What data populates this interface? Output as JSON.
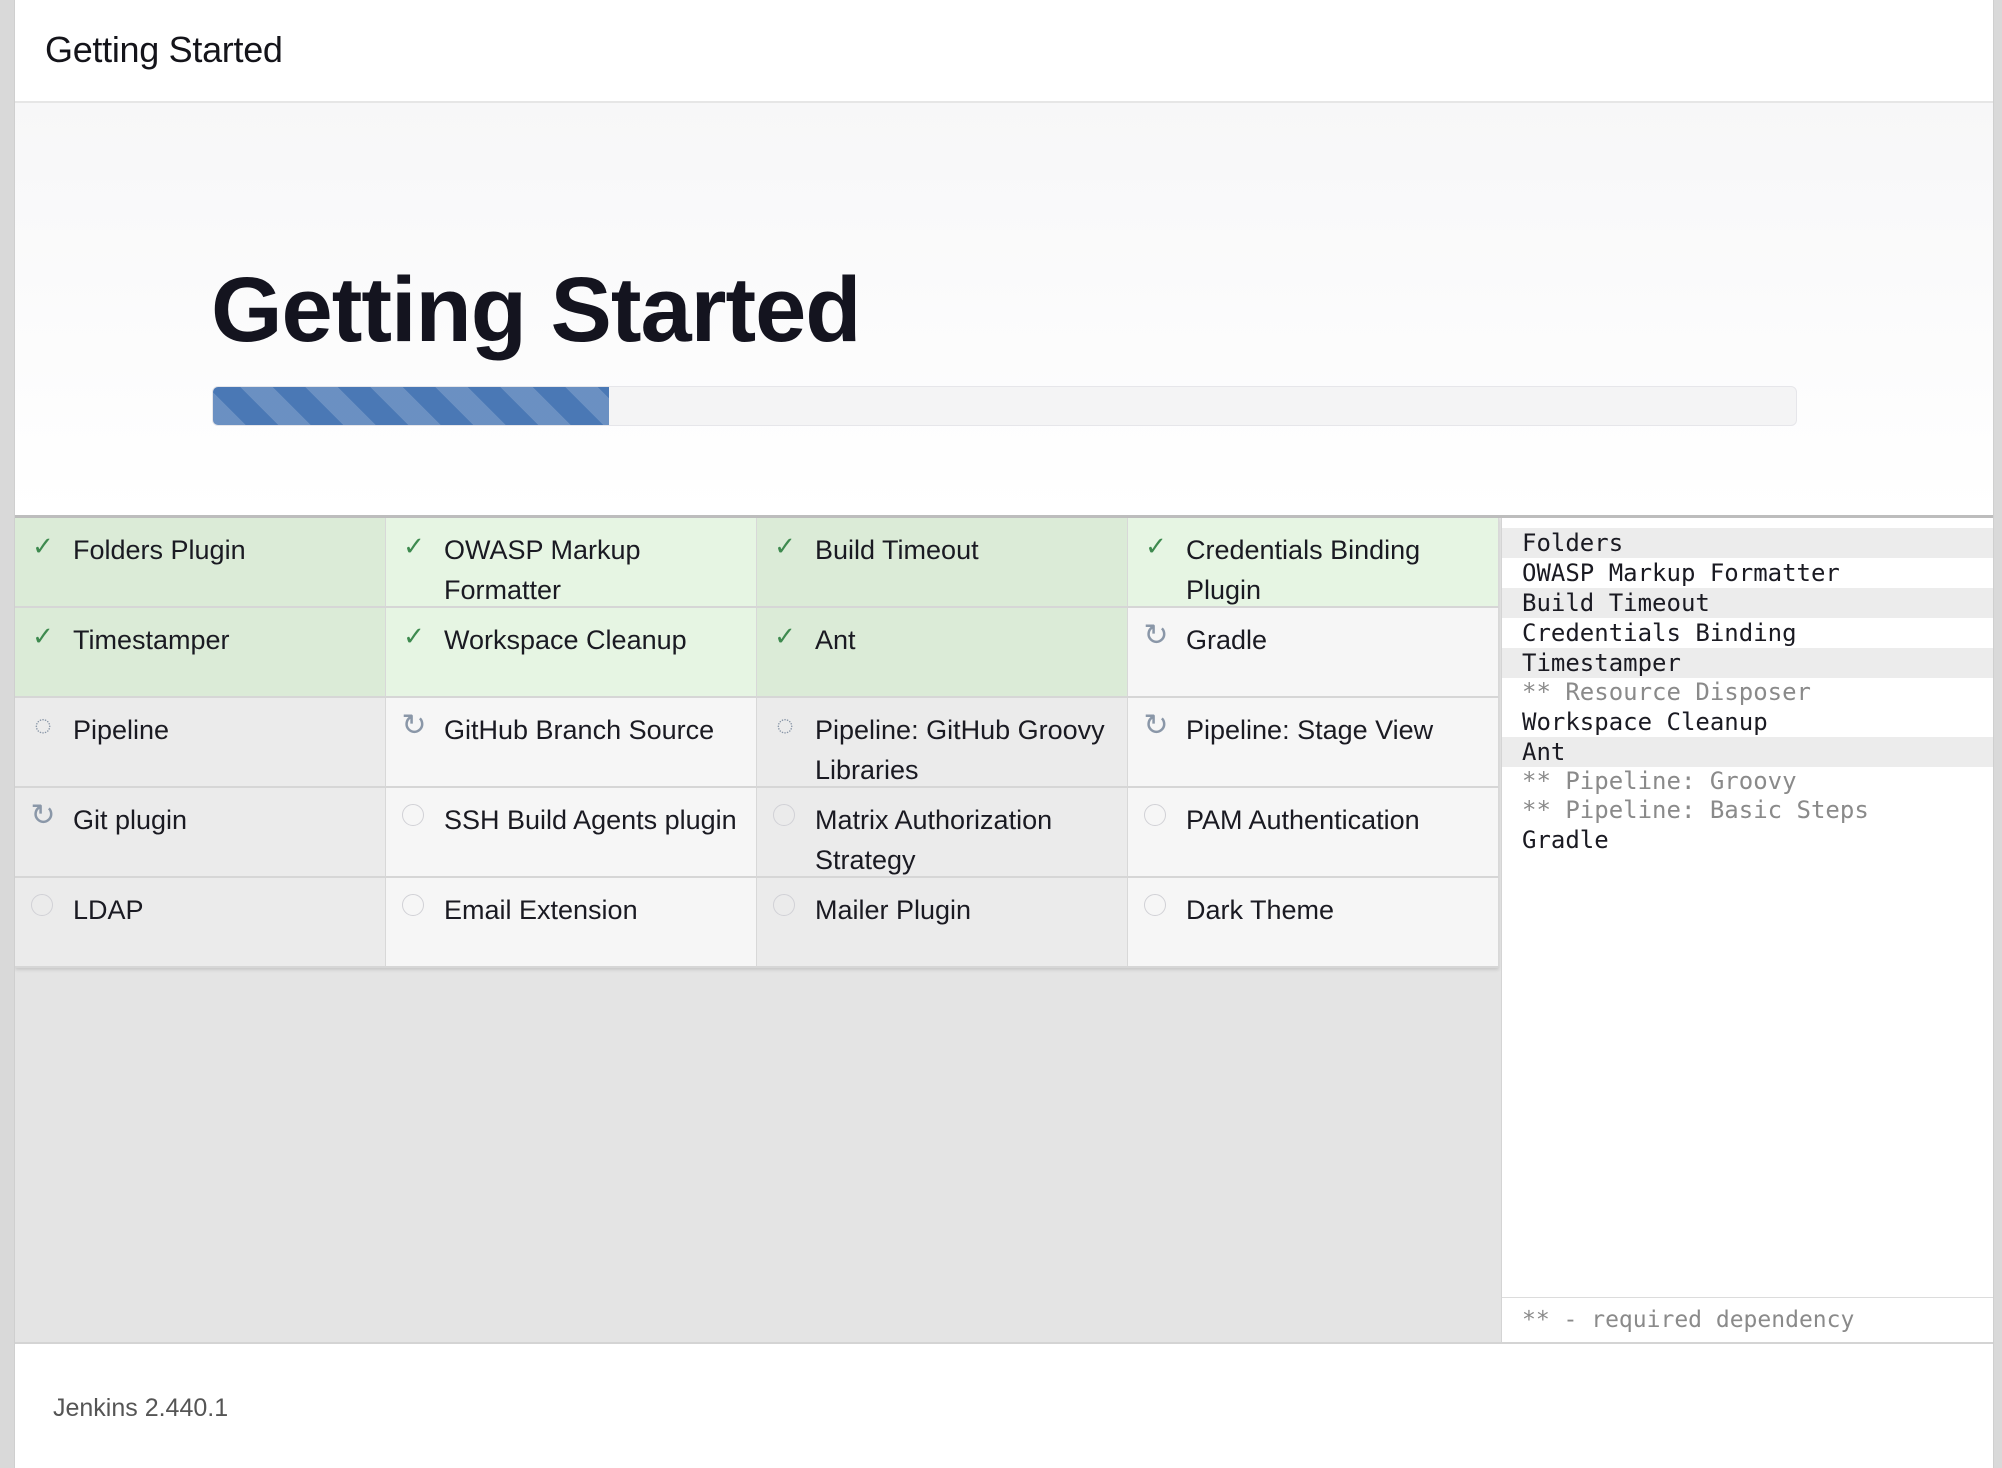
{
  "header": {
    "title": "Getting Started"
  },
  "hero": {
    "heading": "Getting Started",
    "progress_percent": 25
  },
  "plugins": [
    {
      "label": "Folders Plugin",
      "status": "done",
      "icon": "check-icon"
    },
    {
      "label": "OWASP Markup Formatter",
      "status": "done",
      "icon": "check-icon"
    },
    {
      "label": "Build Timeout",
      "status": "done",
      "icon": "check-icon"
    },
    {
      "label": "Credentials Binding Plugin",
      "status": "done",
      "icon": "check-icon"
    },
    {
      "label": "Timestamper",
      "status": "done",
      "icon": "check-icon"
    },
    {
      "label": "Workspace Cleanup",
      "status": "done",
      "icon": "check-icon"
    },
    {
      "label": "Ant",
      "status": "done",
      "icon": "check-icon"
    },
    {
      "label": "Gradle",
      "status": "installing",
      "icon": "refresh-icon"
    },
    {
      "label": "Pipeline",
      "status": "installing",
      "icon": "spinner-icon"
    },
    {
      "label": "GitHub Branch Source",
      "status": "installing",
      "icon": "refresh-icon"
    },
    {
      "label": "Pipeline: GitHub Groovy Libraries",
      "status": "installing",
      "icon": "spinner-icon"
    },
    {
      "label": "Pipeline: Stage View",
      "status": "installing",
      "icon": "refresh-icon"
    },
    {
      "label": "Git plugin",
      "status": "installing",
      "icon": "refresh-icon"
    },
    {
      "label": "SSH Build Agents plugin",
      "status": "pending",
      "icon": "pending-circle-icon"
    },
    {
      "label": "Matrix Authorization Strategy",
      "status": "pending",
      "icon": "pending-circle-icon"
    },
    {
      "label": "PAM Authentication",
      "status": "pending",
      "icon": "pending-circle-icon"
    },
    {
      "label": "LDAP",
      "status": "pending",
      "icon": "pending-circle-icon"
    },
    {
      "label": "Email Extension",
      "status": "pending",
      "icon": "pending-circle-icon"
    },
    {
      "label": "Mailer Plugin",
      "status": "pending",
      "icon": "pending-circle-icon"
    },
    {
      "label": "Dark Theme",
      "status": "pending",
      "icon": "pending-circle-icon"
    }
  ],
  "install_log": [
    {
      "text": "Folders",
      "type": "plugin"
    },
    {
      "text": "OWASP Markup Formatter",
      "type": "plugin"
    },
    {
      "text": "Build Timeout",
      "type": "plugin"
    },
    {
      "text": "Credentials Binding",
      "type": "plugin"
    },
    {
      "text": "Timestamper",
      "type": "plugin"
    },
    {
      "text": "** Resource Disposer",
      "type": "dependency"
    },
    {
      "text": "Workspace Cleanup",
      "type": "plugin"
    },
    {
      "text": "Ant",
      "type": "plugin"
    },
    {
      "text": "** Pipeline: Groovy",
      "type": "dependency"
    },
    {
      "text": "** Pipeline: Basic Steps",
      "type": "dependency"
    },
    {
      "text": "Gradle",
      "type": "plugin"
    }
  ],
  "legend": "** - required dependency",
  "footer": {
    "version": "Jenkins 2.440.1"
  },
  "colors": {
    "done_bg": "#dbebd7",
    "progress_fill": "#4a78b5",
    "check": "#3e8a4f"
  }
}
